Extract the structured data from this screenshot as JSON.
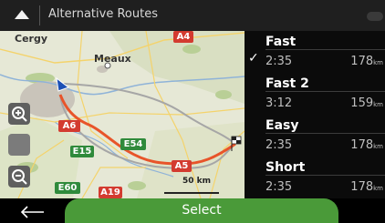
{
  "header": {
    "title": "Alternative Routes"
  },
  "map": {
    "cities": [
      "Cergy",
      "Meaux"
    ],
    "road_labels": [
      "A4",
      "A6",
      "E15",
      "E54",
      "A5",
      "E60",
      "A19"
    ],
    "scale_label": "50 km"
  },
  "routes": [
    {
      "name": "Fast",
      "time": "2:35",
      "distance": "178",
      "unit": "km",
      "selected": true
    },
    {
      "name": "Fast 2",
      "time": "3:12",
      "distance": "159",
      "unit": "km",
      "selected": false
    },
    {
      "name": "Easy",
      "time": "2:35",
      "distance": "178",
      "unit": "km",
      "selected": false
    },
    {
      "name": "Short",
      "time": "2:35",
      "distance": "178",
      "unit": "km",
      "selected": false
    }
  ],
  "footer": {
    "select_label": "Select"
  },
  "colors": {
    "route": "#e8542a",
    "accent": "#4a9a39",
    "road_label": "#d33b30",
    "euro_label": "#2f8a3b"
  },
  "icons": [
    "up-arrow-icon",
    "chat-icon",
    "zoom-in-icon",
    "zoom-out-icon",
    "back-arrow-icon",
    "check-icon",
    "finish-flag-icon",
    "position-arrow-icon"
  ]
}
